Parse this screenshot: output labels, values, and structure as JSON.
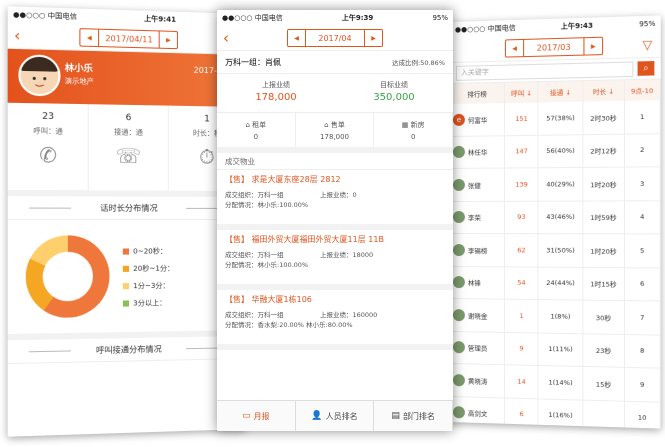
{
  "left": {
    "status": {
      "carrier": "●●○○○ 中国电信",
      "time": "上午9:41"
    },
    "date": "2017/04/11",
    "profile": {
      "name": "林小乐",
      "company": "演示地产",
      "date": "2017-04-11"
    },
    "stats": [
      {
        "value": "23",
        "label": "呼叫：通"
      },
      {
        "value": "6",
        "label": "接通：通"
      },
      {
        "value": "1",
        "label": "时长：秒"
      }
    ],
    "section_duration": "话时长分布情况",
    "legend": [
      "0~20秒：",
      "20秒~1分：",
      "1分~3分：",
      "3分以上："
    ],
    "legend_colors": [
      "#f0773b",
      "#f5a623",
      "#ffcf6e",
      "#8cc152"
    ],
    "section_connect": "呼叫接通分布情况"
  },
  "mid": {
    "status": {
      "carrier": "●●○○○ 中国电信",
      "time": "上午9:39",
      "battery": "95%"
    },
    "date": "2017/04",
    "org": {
      "label": "万科一组：肖佩",
      "rate": "达成比例:50.86%"
    },
    "perf": [
      {
        "label": "上报业绩",
        "value": "178,000",
        "color": "#e0541e"
      },
      {
        "label": "目标业绩",
        "value": "350,000",
        "color": "#3aa04a"
      }
    ],
    "types": [
      {
        "label": "租单",
        "value": "0"
      },
      {
        "label": "售单",
        "value": "178,000"
      },
      {
        "label": "新房",
        "value": "0"
      }
    ],
    "deals_header": "成交物业",
    "deals": [
      {
        "title": "【售】 求是大厦东座28层 2812",
        "org": "成交组织：万科一组",
        "amount": "上报业绩：0",
        "alloc": "分配情况：林小乐:100.00%"
      },
      {
        "title": "【售】 福田外贸大厦福田外贸大厦11层 11B",
        "org": "成交组织：万科一组",
        "amount": "上报业绩：18000",
        "alloc": "分配情况：林小乐:100.00%"
      },
      {
        "title": "【售】 华融大厦1栋106",
        "org": "成交组织：万科一组",
        "amount": "上报业绩：160000",
        "alloc": "分配情况：香水梨:20.00%  林小乐:80.00%"
      }
    ],
    "tabs": [
      "月报",
      "人员排名",
      "部门排名"
    ]
  },
  "right": {
    "status": {
      "carrier": "●●○○○ 中国电信",
      "time": "上午9:43",
      "battery": "95%"
    },
    "date": "2017/03",
    "search_placeholder": "入关键字",
    "headers": [
      "排行榜",
      "呼叫 ↓",
      "接通 ↓",
      "时长 ↓",
      "9点-10"
    ],
    "rows": [
      {
        "name": "何富华",
        "calls": "151",
        "conn": "57(38%)",
        "dur": "2时30秒",
        "rank": "1"
      },
      {
        "name": "林任华",
        "calls": "147",
        "conn": "56(40%)",
        "dur": "2时12秒",
        "rank": "2"
      },
      {
        "name": "张健",
        "calls": "139",
        "conn": "40(29%)",
        "dur": "1时20秒",
        "rank": "3"
      },
      {
        "name": "李荣",
        "calls": "93",
        "conn": "43(46%)",
        "dur": "1时59秒",
        "rank": "4"
      },
      {
        "name": "李锡榜",
        "calls": "62",
        "conn": "31(50%)",
        "dur": "1时20秒",
        "rank": "5"
      },
      {
        "name": "林锋",
        "calls": "54",
        "conn": "24(44%)",
        "dur": "1时15秒",
        "rank": "6"
      },
      {
        "name": "谢晓金",
        "calls": "1",
        "conn": "1(8%)",
        "dur": "30秒",
        "rank": "7"
      },
      {
        "name": "管理员",
        "calls": "9",
        "conn": "1(11%)",
        "dur": "23秒",
        "rank": "8"
      },
      {
        "name": "黄晓涛",
        "calls": "14",
        "conn": "1(14%)",
        "dur": "15秒",
        "rank": "9"
      },
      {
        "name": "高剑文",
        "calls": "6",
        "conn": "1(16%)",
        "dur": "",
        "rank": "10"
      }
    ]
  }
}
